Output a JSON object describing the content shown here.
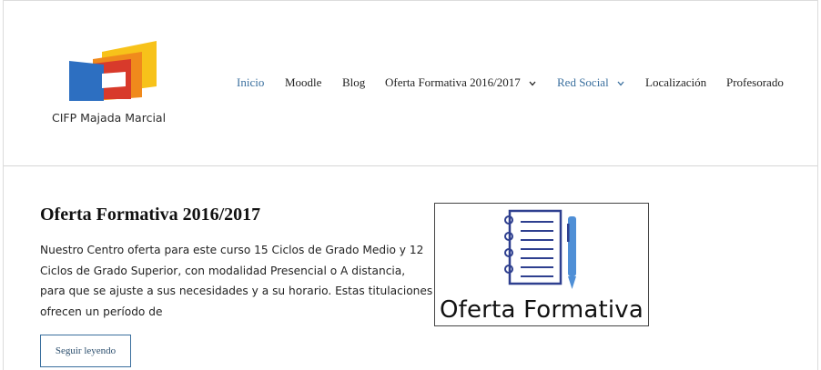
{
  "site": {
    "name": "CIFP Majada Marcial"
  },
  "nav": {
    "items": [
      {
        "label": "Inicio"
      },
      {
        "label": "Moodle"
      },
      {
        "label": "Blog"
      },
      {
        "label": "Oferta Formativa 2016/2017"
      },
      {
        "label": "Red Social"
      },
      {
        "label": "Localización"
      },
      {
        "label": "Profesorado"
      }
    ]
  },
  "post": {
    "title": "Oferta Formativa 2016/2017",
    "excerpt_lines": [
      "Nuestro Centro oferta para este curso 15 Ciclos de Grado Medio y 12",
      "Ciclos de Grado Superior, con modalidad Presencial o A distancia,",
      "para que se ajuste a sus necesidades y a su horario. Estas titulaciones",
      "ofrecen un período de"
    ],
    "read_more": "Seguir leyendo",
    "thumbnail_text": "Oferta Formativa"
  },
  "colors": {
    "accent": "#3a6f9e",
    "logo_blue": "#2d6fc1",
    "logo_red": "#d83a2b",
    "logo_orange": "#f08a1c",
    "logo_yellow": "#f7c21a",
    "notebook_blue": "#2e3f8f",
    "pen_blue": "#4f8fd6"
  }
}
